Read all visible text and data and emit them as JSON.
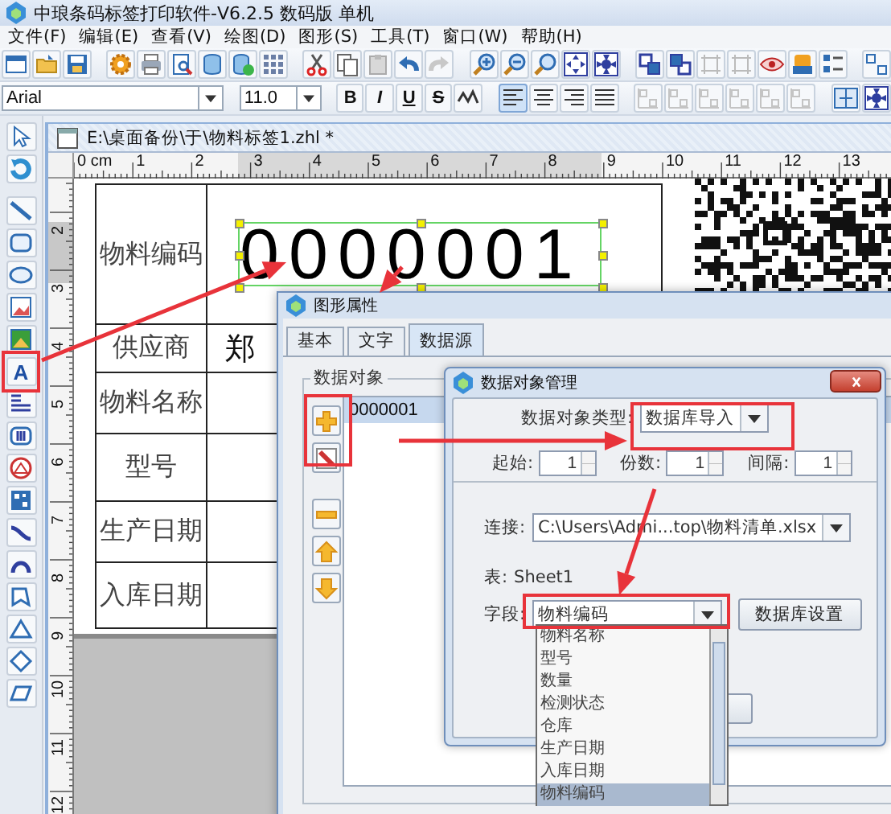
{
  "window": {
    "title": "中琅条码标签打印软件-V6.2.5 数码版 单机"
  },
  "menu": [
    "文件(F)",
    "编辑(E)",
    "查看(V)",
    "绘图(D)",
    "图形(S)",
    "工具(T)",
    "窗口(W)",
    "帮助(H)"
  ],
  "format_bar": {
    "font": "Arial",
    "size": "11.0",
    "styles": [
      "B",
      "I",
      "U",
      "S"
    ],
    "align_buttons": [
      {
        "kind": "left",
        "selected": true
      },
      {
        "kind": "center",
        "selected": false
      },
      {
        "kind": "right",
        "selected": false
      },
      {
        "kind": "justify",
        "selected": false
      }
    ]
  },
  "tools": [
    {
      "kind": "pointer"
    },
    {
      "kind": "rotate"
    },
    {
      "kind": "line"
    },
    {
      "kind": "rect"
    },
    {
      "kind": "ellipse"
    },
    {
      "kind": "image"
    },
    {
      "kind": "image_green"
    },
    {
      "kind": "text",
      "glyph": "A"
    },
    {
      "kind": "paragraph"
    },
    {
      "kind": "barcode"
    },
    {
      "kind": "target"
    },
    {
      "kind": "matrix"
    },
    {
      "kind": "curve"
    },
    {
      "kind": "arc"
    },
    {
      "kind": "polygon"
    },
    {
      "kind": "triangle"
    },
    {
      "kind": "diamond"
    },
    {
      "kind": "parallelogram"
    }
  ],
  "document": {
    "title": "E:\\桌面备份\\于\\物料标签1.zhl *",
    "ruler_h": [
      "0 cm",
      "1",
      "2",
      "3",
      "4",
      "5",
      "6",
      "7",
      "8",
      "9",
      "10",
      "11",
      "12",
      "13"
    ],
    "ruler_v": [
      "2",
      "3",
      "4",
      "5",
      "6",
      "7",
      "8",
      "9",
      "10",
      "11",
      "12"
    ],
    "rows": [
      {
        "label": "物料编码"
      },
      {
        "label": "供应商",
        "value": "郑"
      },
      {
        "label": "物料名称"
      },
      {
        "label": "型号"
      },
      {
        "label": "生产日期"
      },
      {
        "label": "入库日期"
      }
    ],
    "text_object": {
      "text": "0000001",
      "selected": true
    }
  },
  "properties_dialog": {
    "title": "图形属性",
    "tabs": [
      {
        "label": "基本",
        "selected": false
      },
      {
        "label": "文字",
        "selected": false
      },
      {
        "label": "数据源",
        "selected": true
      }
    ],
    "group": "数据对象",
    "items": [
      {
        "text": "0000001",
        "selected": true
      }
    ]
  },
  "manager_dialog": {
    "title": "数据对象管理",
    "type_label": "数据对象类型:",
    "type_value": "数据库导入",
    "spinners": [
      {
        "label": "起始:",
        "value": "1"
      },
      {
        "label": "份数:",
        "value": "1"
      },
      {
        "label": "间隔:",
        "value": "1"
      }
    ],
    "connection_label": "连接:",
    "connection": "C:\\Users\\Admi...top\\物料清单.xlsx",
    "table_label": "表:",
    "table": "Sheet1",
    "field_label": "字段:",
    "field": "物料编码",
    "db_button": "数据库设置",
    "field_options": [
      {
        "text": "物料名称",
        "selected": false
      },
      {
        "text": "型号",
        "selected": false
      },
      {
        "text": "数量",
        "selected": false
      },
      {
        "text": "检测状态",
        "selected": false
      },
      {
        "text": "仓库",
        "selected": false
      },
      {
        "text": "生产日期",
        "selected": false
      },
      {
        "text": "入库日期",
        "selected": false
      },
      {
        "text": "物料编码",
        "selected": true
      }
    ]
  }
}
